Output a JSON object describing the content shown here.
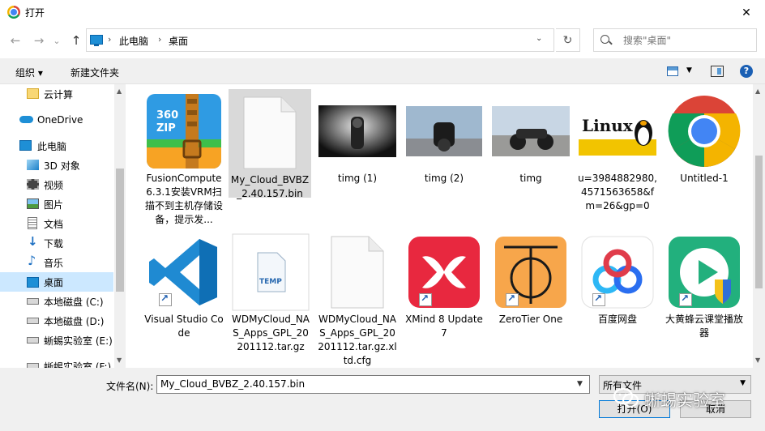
{
  "window": {
    "title": "打开",
    "close": "✕"
  },
  "nav": {
    "back": "←",
    "forward": "→",
    "recent": "⌄",
    "up": "↑",
    "crumbs": [
      "此电脑",
      "桌面"
    ],
    "refresh": "↻",
    "search_placeholder": "搜索\"桌面\""
  },
  "toolbar": {
    "organize": "组织 ▾",
    "new_folder": "新建文件夹",
    "help": "?"
  },
  "sidebar": {
    "items": [
      {
        "label": "云计算",
        "icon": "folder-icon"
      },
      {
        "label": "OneDrive",
        "icon": "cloud-icon"
      },
      {
        "label": "此电脑",
        "icon": "computer-icon"
      },
      {
        "label": "3D 对象",
        "icon": "cube-icon"
      },
      {
        "label": "视频",
        "icon": "video-icon"
      },
      {
        "label": "图片",
        "icon": "picture-icon"
      },
      {
        "label": "文档",
        "icon": "document-icon"
      },
      {
        "label": "下载",
        "icon": "download-icon"
      },
      {
        "label": "音乐",
        "icon": "music-icon"
      },
      {
        "label": "桌面",
        "icon": "desktop-icon"
      },
      {
        "label": "本地磁盘 (C:)",
        "icon": "drive-icon"
      },
      {
        "label": "本地磁盘 (D:)",
        "icon": "drive-icon"
      },
      {
        "label": "蜥蜴实验室 (E:)",
        "icon": "drive-icon"
      },
      {
        "label": "蜥蜴实验室 (F:)",
        "icon": "drive-icon"
      }
    ]
  },
  "files": [
    {
      "name": "FusionCompute 6.3.1安装VRM扫描不到主机存储设备，提示发...",
      "icon": "zip-archive-icon"
    },
    {
      "name": "My_Cloud_BVBZ_2.40.157.bin",
      "icon": "blank-file-icon",
      "selected": true
    },
    {
      "name": "timg (1)",
      "icon": "image-thumbnail-icon"
    },
    {
      "name": "timg (2)",
      "icon": "image-thumbnail-icon"
    },
    {
      "name": "timg",
      "icon": "image-thumbnail-icon"
    },
    {
      "name": "u=3984882980,4571563658&fm=26&gp=0",
      "icon": "image-thumbnail-icon",
      "thumb_text": "Linux"
    },
    {
      "name": "Untitled-1",
      "icon": "chrome-icon"
    },
    {
      "name": "Visual Studio Code",
      "icon": "vscode-icon",
      "shortcut": true
    },
    {
      "name": "WDMyCloud_NAS_Apps_GPL_20201112.tar.gz",
      "icon": "temp-file-icon",
      "thumb_text": "TEMP"
    },
    {
      "name": "WDMyCloud_NAS_Apps_GPL_20201112.tar.gz.xltd.cfg",
      "icon": "blank-file-icon"
    },
    {
      "name": "XMind 8 Update 7",
      "icon": "xmind-icon",
      "shortcut": true
    },
    {
      "name": "ZeroTier One",
      "icon": "zerotier-icon",
      "shortcut": true
    },
    {
      "name": "百度网盘",
      "icon": "baidu-netdisk-icon",
      "shortcut": true
    },
    {
      "name": "大黄蜂云课堂播放器",
      "icon": "player-icon",
      "shortcut": true
    }
  ],
  "bottom": {
    "filename_label": "文件名(N):",
    "filename_value": "My_Cloud_BVBZ_2.40.157.bin",
    "filetype": "所有文件",
    "open": "打开(O)",
    "cancel": "取消"
  },
  "watermark": {
    "text": "蜥蜴实验室"
  },
  "colors": {
    "selection": "#cce8ff",
    "tile_selected": "#d9d9d9",
    "chrome_bg": "#f0f0f0",
    "accent": "#0078d7"
  }
}
